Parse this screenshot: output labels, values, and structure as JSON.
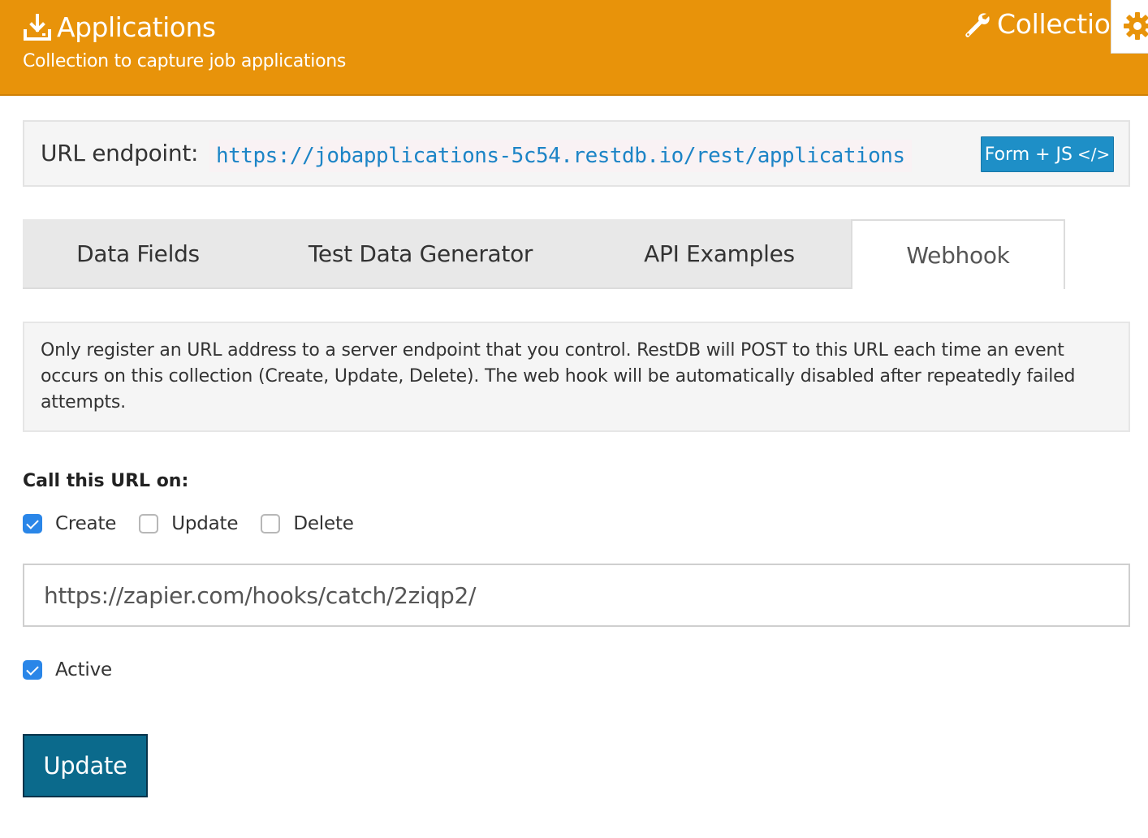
{
  "header": {
    "title": "Applications",
    "subtitle": "Collection to capture job applications",
    "right_label": "Collection",
    "icons": {
      "title": "download-icon",
      "right": "wrench-icon",
      "settings": "gear-icon"
    },
    "colors": {
      "background": "#e8930a",
      "text": "#ffffff"
    }
  },
  "endpoint": {
    "label": "URL endpoint:",
    "url": "https://jobapplications-5c54.restdb.io/rest/applications",
    "button_label": "Form + JS",
    "button_icon": "</>",
    "colors": {
      "url_text": "#1c84c6",
      "button": "#1e8fc7"
    }
  },
  "tabs": [
    {
      "label": "Data Fields",
      "active": false
    },
    {
      "label": "Test Data Generator",
      "active": false
    },
    {
      "label": "API Examples",
      "active": false
    },
    {
      "label": "Webhook",
      "active": true
    }
  ],
  "webhook": {
    "info": "Only register an URL address to a server endpoint that you control. RestDB will POST to this URL each time an event occurs on this collection (Create, Update, Delete). The web hook will be automatically disabled after repeatedly failed attempts.",
    "call_label": "Call this URL on:",
    "events": [
      {
        "label": "Create",
        "checked": true
      },
      {
        "label": "Update",
        "checked": false
      },
      {
        "label": "Delete",
        "checked": false
      }
    ],
    "url_value": "https://zapier.com/hooks/catch/2ziqp2/",
    "active_label": "Active",
    "active_checked": true,
    "update_button": "Update",
    "colors": {
      "checkbox": "#2a86e8",
      "update_button": "#0b6a8c"
    }
  }
}
